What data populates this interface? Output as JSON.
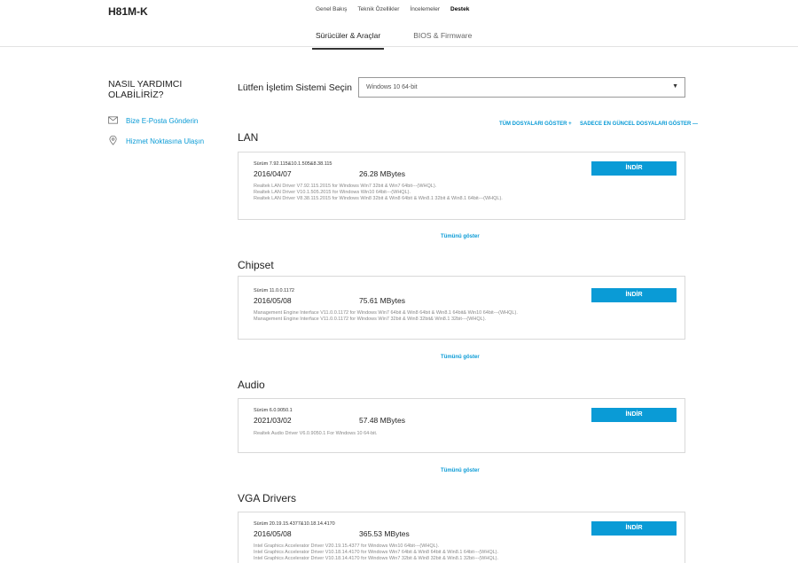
{
  "header": {
    "product": "H81M-K",
    "nav": [
      "Genel Bakış",
      "Teknik Özellikler",
      "İncelemeler",
      "Destek"
    ],
    "tabs": [
      "Sürücüler & Araçlar",
      "BIOS & Firmware"
    ]
  },
  "help": {
    "title": "NASIL YARDIMCI OLABİLİRİZ?",
    "email": "Bize E-Posta Gönderin",
    "service": "Hizmet Noktasına Ulaşın"
  },
  "os": {
    "label": "Lütfen İşletim Sistemi Seçin",
    "selected": "Windows 10 64-bit",
    "caret": "▼"
  },
  "file_toggles": {
    "show_all": "TÜM DOSYALARI GÖSTER +",
    "latest_only": "SADECE EN GÜNCEL DOSYALARI GÖSTER —"
  },
  "download_label": "İNDİR",
  "show_all_label": "Tümünü göster",
  "categories": [
    {
      "title": "LAN",
      "version": "Sürüm 7.92.115&10.1.505&8.38.115",
      "date": "2016/04/07",
      "size": "26.28 MBytes",
      "desc": [
        "Realtek LAN Driver V7.92.115.2015 for Windows Win7 32bit & Win7 64bit---(WHQL).",
        "Realtek LAN Driver V10.1.505.2015 for Windows Win10 64bit---(WHQL).",
        "Realtek LAN Driver V8.38.115.2015 for Windows Win8 32bit & Win8 64bit & Win8.1 32bit & Win8.1 64bit---(WHQL)."
      ]
    },
    {
      "title": "Chipset",
      "version": "Sürüm 11.0.0.1172",
      "date": "2016/05/08",
      "size": "75.61 MBytes",
      "desc": [
        "Management Engine Interface V11.0.0.1172 for Windows Win7 64bit & Win8 64bit & Win8.1 64bit& Win10 64bit---(WHQL).",
        "Management Engine Interface V11.0.0.1172 for Windows Win7 32bit & Win8 32bit& Win8.1 32bit---(WHQL)."
      ]
    },
    {
      "title": "Audio",
      "version": "Sürüm 6.0.9050.1",
      "date": "2021/03/02",
      "size": "57.48 MBytes",
      "desc": [
        "Realtek Audio Driver V6.0.9050.1 For Windows 10 64-bit."
      ]
    },
    {
      "title": "VGA Drivers",
      "version": "Sürüm 20.19.15.4377&10.18.14.4170",
      "date": "2016/05/08",
      "size": "365.53 MBytes",
      "desc": [
        "Intel Graphics Accelerator Driver V20.19.15.4377 for Windows Win10 64bit---(WHQL).",
        "Intel Graphics Accelerator Driver V10.18.14.4170 for Windows Win7 64bit & Win8 64bit & Win8.1 64bit---(WHQL).",
        "Intel Graphics Accelerator Driver V10.18.14.4170 for Windows Win7 32bit & Win8 32bit & Win8.1 32bit---(WHQL)."
      ]
    }
  ]
}
